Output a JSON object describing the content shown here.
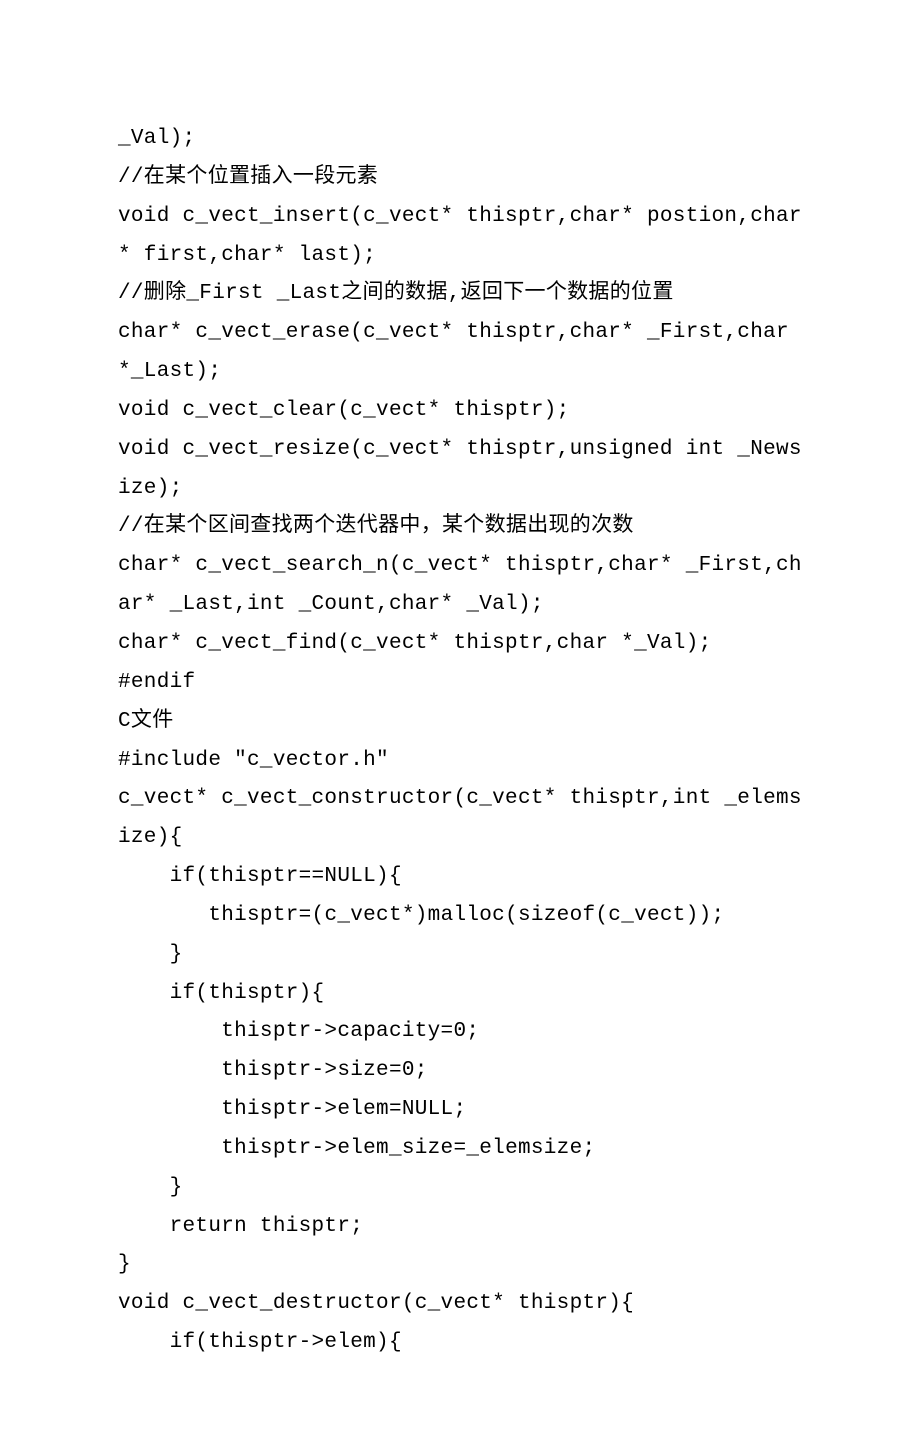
{
  "lines": [
    "_Val);",
    "//在某个位置插入一段元素",
    "void c_vect_insert(c_vect* thisptr,char* postion,char* first,char* last);",
    "//删除_First _Last之间的数据,返回下一个数据的位置",
    "char* c_vect_erase(c_vect* thisptr,char* _First,char *_Last);",
    "void c_vect_clear(c_vect* thisptr);",
    "void c_vect_resize(c_vect* thisptr,unsigned int _Newsize);",
    "//在某个区间查找两个迭代器中，某个数据出现的次数",
    "char* c_vect_search_n(c_vect* thisptr,char* _First,char* _Last,int _Count,char* _Val);",
    "char* c_vect_find(c_vect* thisptr,char *_Val);",
    "#endif",
    "",
    "C文件",
    "#include \"c_vector.h\"",
    "c_vect* c_vect_constructor(c_vect* thisptr,int _elemsize){",
    "    if(thisptr==NULL){",
    "       thisptr=(c_vect*)malloc(sizeof(c_vect));",
    "    }",
    "    if(thisptr){",
    "        thisptr->capacity=0;",
    "        thisptr->size=0;",
    "        thisptr->elem=NULL;",
    "        thisptr->elem_size=_elemsize;",
    "    }",
    "    return thisptr;",
    "}",
    "",
    "void c_vect_destructor(c_vect* thisptr){",
    "    if(thisptr->elem){"
  ]
}
